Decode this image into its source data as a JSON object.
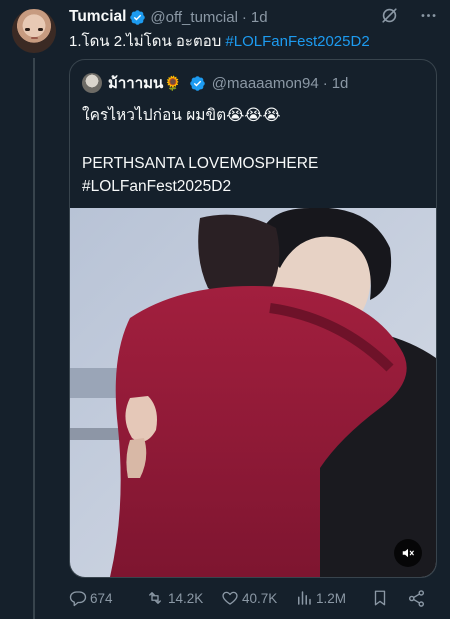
{
  "author": {
    "display_name": "Tumcial",
    "handle": "@off_tumcial",
    "time": "1d"
  },
  "tweet": {
    "text": "1.โดน 2.ไม่โดน อะตอบ ",
    "hashtag": "#LOLFanFest2025D2"
  },
  "quoted": {
    "display_name": "ม้าาามน",
    "name_emoji": "🌻",
    "handle": "@maaaamon94",
    "time": "1d",
    "line1": "ใครไหวไปก่อน ผมขิต😭😭😭",
    "line2": "PERTHSANTA LOVEMOSPHERE",
    "line3": "#LOLFanFest2025D2"
  },
  "metrics": {
    "replies": "674",
    "reposts": "14.2K",
    "likes": "40.7K",
    "views": "1.2M"
  },
  "colors": {
    "background": "#15202b",
    "accent": "#1d9bf0",
    "muted": "#8b98a5",
    "border": "#38444d"
  },
  "icons": [
    "verified-badge-icon",
    "grok-icon",
    "more-icon",
    "reply-icon",
    "repost-icon",
    "like-icon",
    "views-icon",
    "bookmark-icon",
    "share-icon",
    "mute-icon"
  ]
}
